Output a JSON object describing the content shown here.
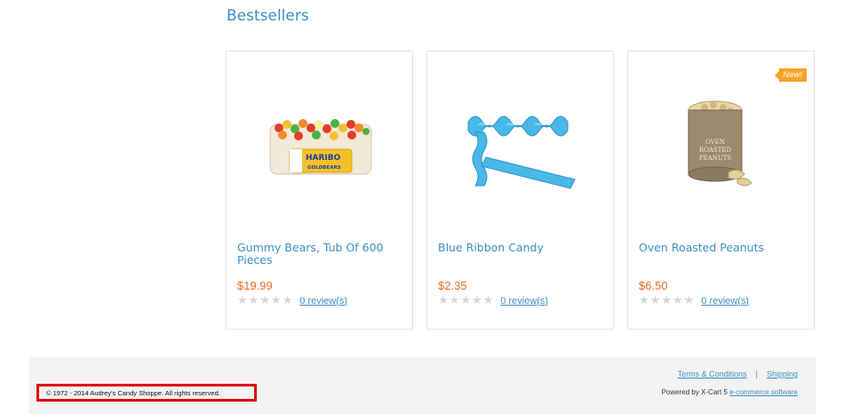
{
  "section": {
    "title": "Bestsellers"
  },
  "products": [
    {
      "name": "Gummy Bears, Tub Of 600 Pieces",
      "price": "$19.99",
      "reviews": "0 review(s)"
    },
    {
      "name": "Blue Ribbon Candy",
      "price": "$2.35",
      "reviews": "0 review(s)"
    },
    {
      "name": "Oven Roasted Peanuts",
      "price": "$6.50",
      "reviews": "0 review(s)",
      "badge": "New!"
    }
  ],
  "colors": {
    "link": "#3a8fc7",
    "price": "#ee6a1f",
    "badge": "#f7a425",
    "highlight": "#e00000"
  },
  "footer": {
    "copyright": "© 1972 - 2014 Audrey's Candy Shoppe. All rights reserved.",
    "terms_label": "Terms & Conditions",
    "separator": "|",
    "shipping_label": "Shipping",
    "powered_prefix": "Powered by X-Cart 5",
    "powered_link": "e-commerce software"
  }
}
